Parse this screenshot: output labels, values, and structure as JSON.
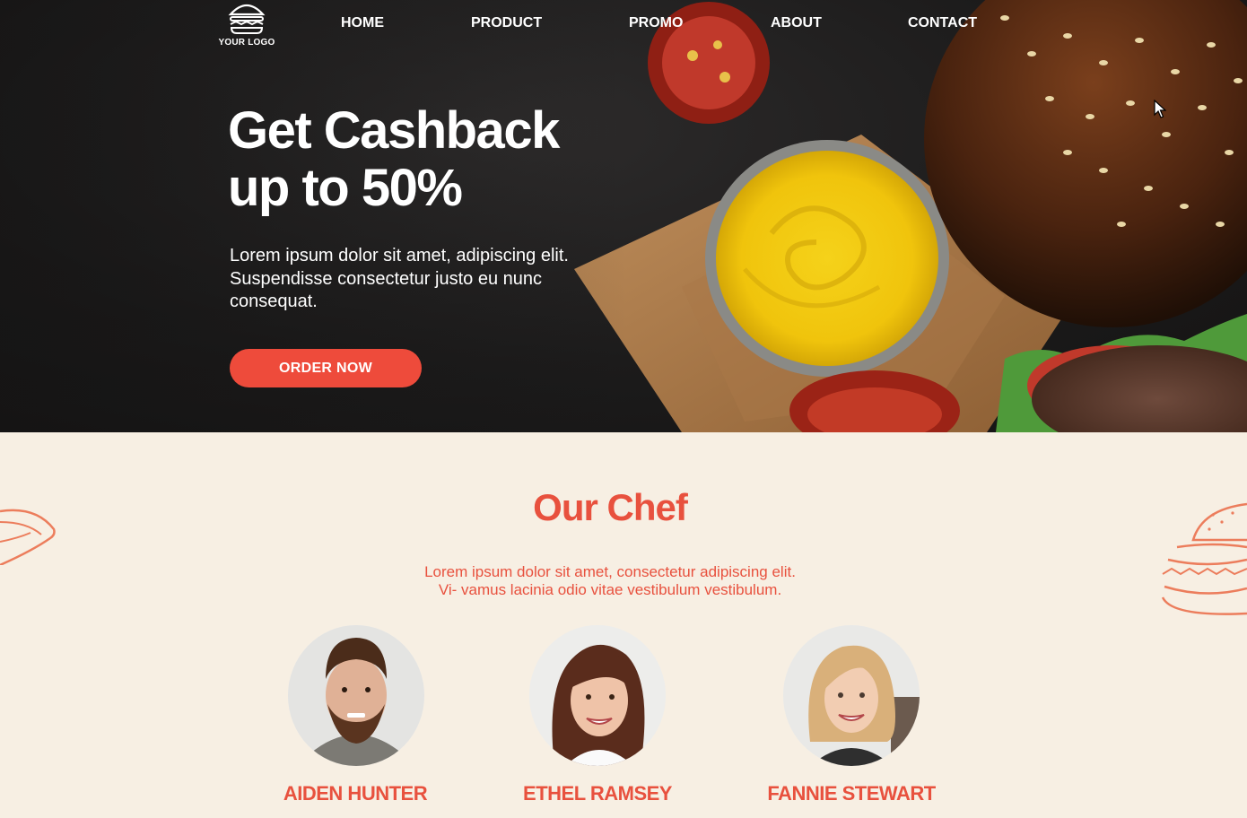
{
  "logo": {
    "text": "YOUR LOGO",
    "icon": "burger-icon"
  },
  "nav": {
    "items": [
      "HOME",
      "PRODUCT",
      "PROMO",
      "ABOUT",
      "CONTACT"
    ]
  },
  "hero": {
    "title_line1": "Get Cashback",
    "title_line2": "up to 50%",
    "description": "Lorem ipsum dolor sit amet, adipiscing elit. Suspendisse consectetur justo eu nunc consequat.",
    "cta_label": "ORDER NOW"
  },
  "chef_section": {
    "title": "Our Chef",
    "description_line1": "Lorem ipsum dolor sit amet, consectetur adipiscing elit.",
    "description_line2": "Vi- vamus lacinia odio vitae vestibulum vestibulum.",
    "chefs": [
      {
        "name": "AIDEN HUNTER"
      },
      {
        "name": "ETHEL RAMSEY"
      },
      {
        "name": "FANNIE STEWART"
      }
    ]
  },
  "colors": {
    "accent": "#ee4b3b",
    "title_red": "#e8513e",
    "cream": "#f7efe3",
    "dark": "#1c1b1b"
  }
}
